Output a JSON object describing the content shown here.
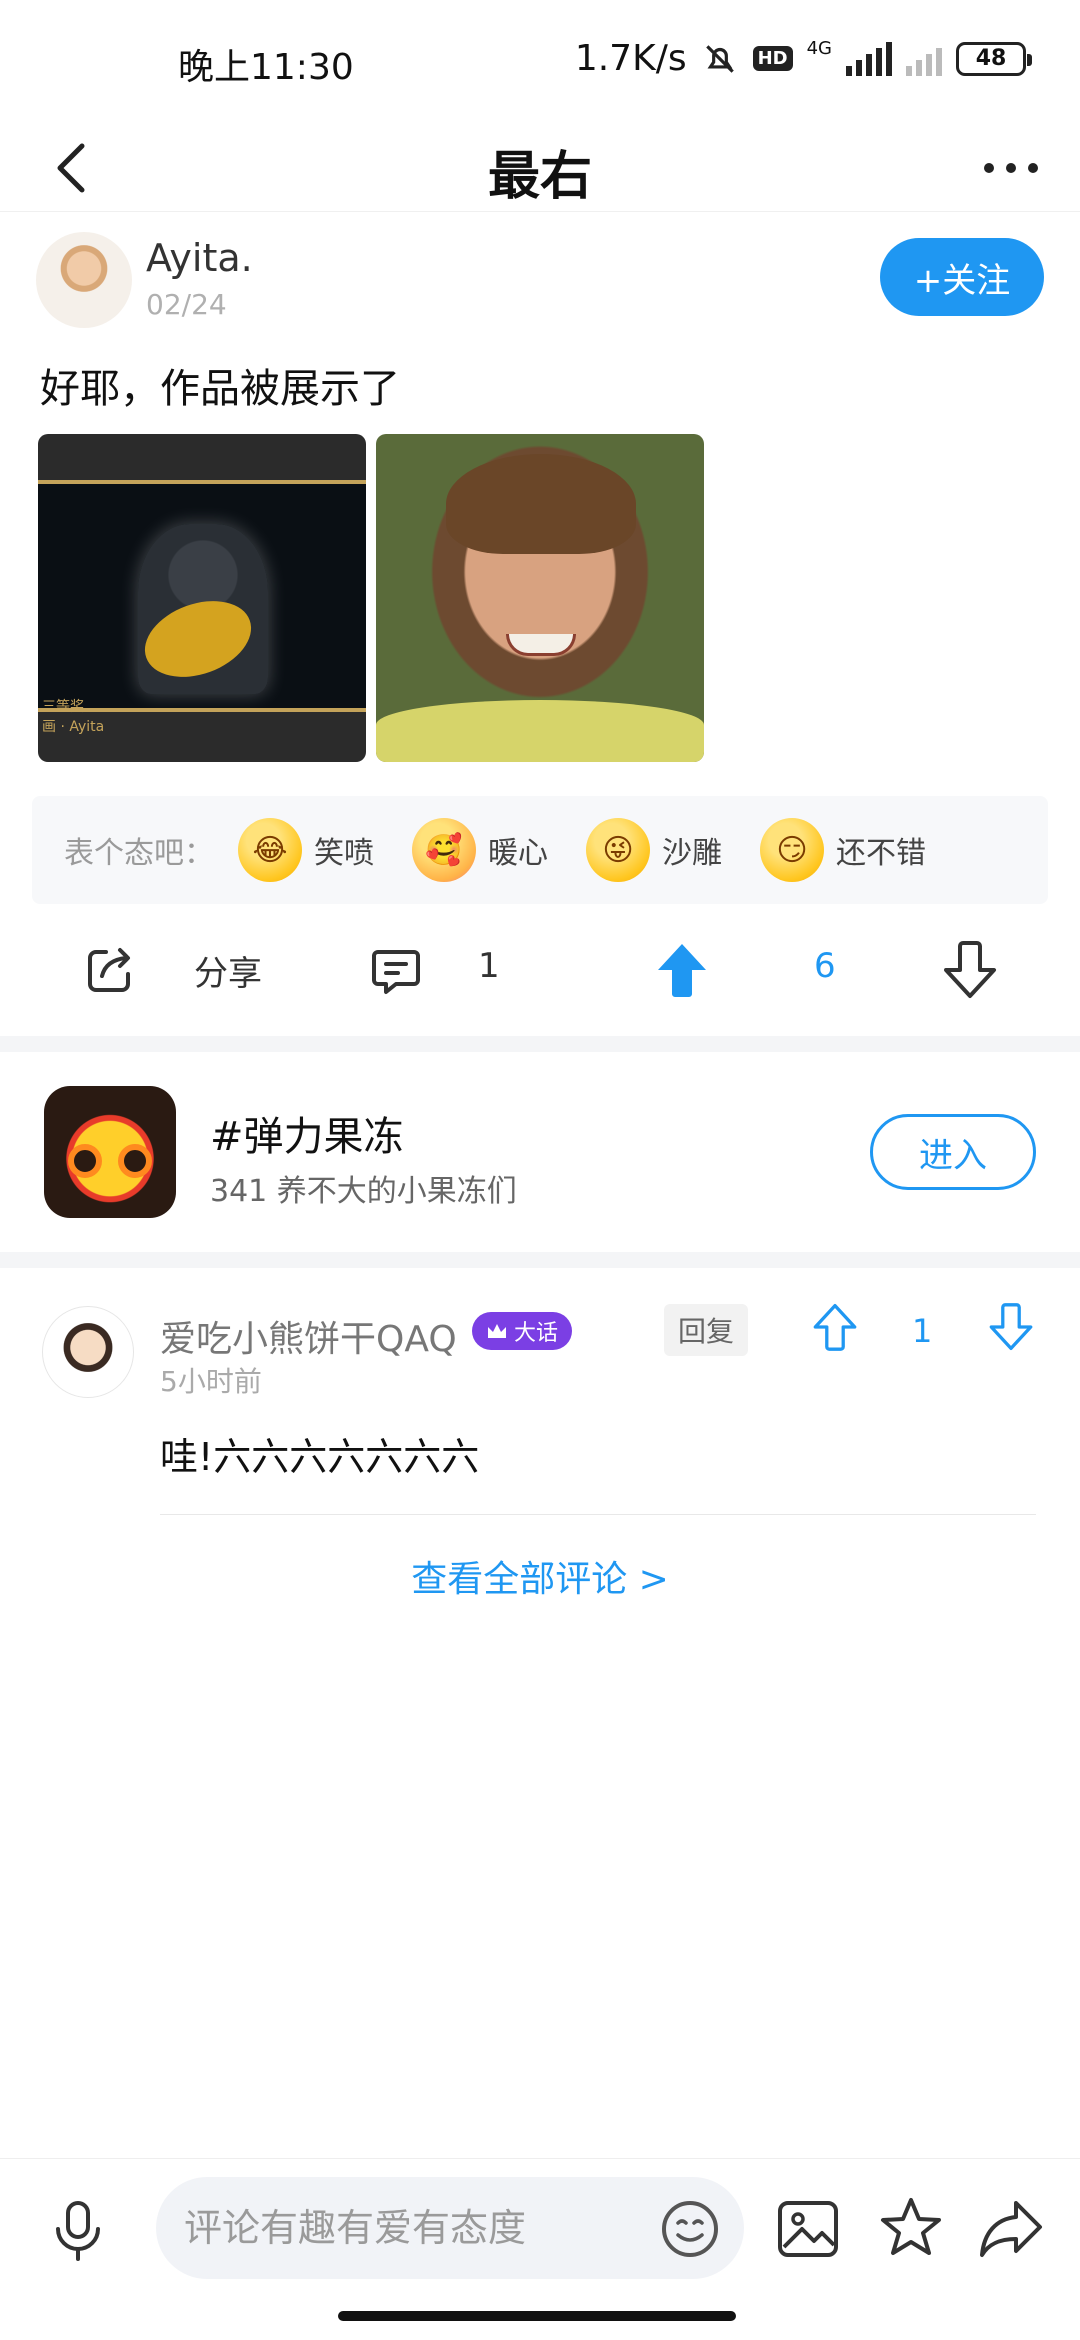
{
  "status_bar": {
    "time": "晚上11:30",
    "network_speed": "1.7K/s",
    "hd_label": "HD",
    "network_type": "4G",
    "battery": "48"
  },
  "nav": {
    "title": "最右"
  },
  "post": {
    "author_name": "Ayita.",
    "date": "02/24",
    "follow_label": "+关注",
    "text": "好耶，作品被展示了",
    "image_caption": "三等奖\n画 · Ayita"
  },
  "reactions": {
    "prompt": "表个态吧：",
    "items": [
      {
        "label": "笑喷",
        "icon": "laughing-tears-emoji",
        "glyph": "😂"
      },
      {
        "label": "暖心",
        "icon": "hug-heart-emoji",
        "glyph": "🥰"
      },
      {
        "label": "沙雕",
        "icon": "silly-face-emoji",
        "glyph": "😜"
      },
      {
        "label": "还不错",
        "icon": "smirk-emoji",
        "glyph": "😏"
      }
    ]
  },
  "actions": {
    "share_label": "分享",
    "comment_count": "1",
    "like_count": "6"
  },
  "topic": {
    "title": "#弹力果冻",
    "subtitle": "341 养不大的小果冻们",
    "enter_label": "进入"
  },
  "comment": {
    "user_name": "爱吃小熊饼干QAQ",
    "badge_label": "大话",
    "time": "5小时前",
    "reply_label": "回复",
    "like_count": "1",
    "text": "哇!六六六六六六六"
  },
  "view_all_label": "查看全部评论 >",
  "bottom_bar": {
    "input_placeholder": "评论有趣有爱有态度"
  },
  "colors": {
    "accent": "#1f97f2",
    "vip": "#7b3fe4"
  }
}
